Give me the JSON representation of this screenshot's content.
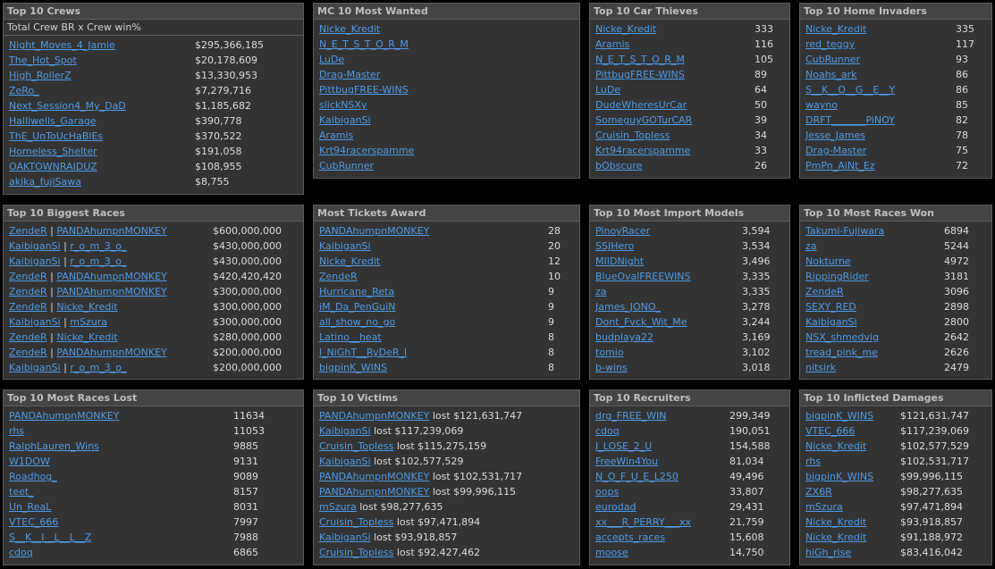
{
  "crews": {
    "title": "Top 10 Crews",
    "subtitle": "Total Crew BR x Crew win%",
    "rows": [
      {
        "name": "Night_Moves_4_Jamie",
        "value": "$295,366,185"
      },
      {
        "name": "The_Hot_Spot",
        "value": "$20,178,609"
      },
      {
        "name": "High_RollerZ",
        "value": "$13,330,953"
      },
      {
        "name": "ZeRo_",
        "value": "$7,279,716"
      },
      {
        "name": "Next_Session4_My_DaD",
        "value": "$1,185,682"
      },
      {
        "name": "Halliwells_Garage",
        "value": "$390,778"
      },
      {
        "name": "ThE_UnToUcHaBlEs",
        "value": "$370,522"
      },
      {
        "name": "Homeless_Shelter",
        "value": "$191,058"
      },
      {
        "name": "OAKTOWNRAIDUZ",
        "value": "$108,955"
      },
      {
        "name": "akika_fujiSawa",
        "value": "$8,755"
      }
    ]
  },
  "most_wanted": {
    "title": "MC 10 Most Wanted",
    "rows": [
      {
        "name": "Nicke_Kredit"
      },
      {
        "name": "N_E_T_S_T_O_R_M"
      },
      {
        "name": "LuDe"
      },
      {
        "name": "Drag-Master"
      },
      {
        "name": "PittbugFREE-WINS"
      },
      {
        "name": "slickNSXy"
      },
      {
        "name": "KaibiganSi"
      },
      {
        "name": "Aramis"
      },
      {
        "name": "Krt94racerspamme"
      },
      {
        "name": "CubRunner"
      }
    ]
  },
  "car_thieves": {
    "title": "Top 10 Car Thieves",
    "rows": [
      {
        "name": "Nicke_Kredit",
        "value": "333"
      },
      {
        "name": "Aramis",
        "value": "116"
      },
      {
        "name": "N_E_T_S_T_O_R_M",
        "value": "105"
      },
      {
        "name": "PittbugFREE-WINS",
        "value": "89"
      },
      {
        "name": "LuDe",
        "value": "64"
      },
      {
        "name": "DudeWheresUrCar",
        "value": "50"
      },
      {
        "name": "SomeguyGOTurCAR",
        "value": "39"
      },
      {
        "name": "Cruisin_Topless",
        "value": "34"
      },
      {
        "name": "Krt94racerspamme",
        "value": "33"
      },
      {
        "name": "bObscure",
        "value": "26"
      }
    ]
  },
  "home_invaders": {
    "title": "Top 10 Home Invaders",
    "rows": [
      {
        "name": "Nicke_Kredit",
        "value": "335"
      },
      {
        "name": "red_teggy",
        "value": "117"
      },
      {
        "name": "CubRunner",
        "value": "93"
      },
      {
        "name": "Noahs_ark",
        "value": "86"
      },
      {
        "name": "S__K__O__G__E__Y",
        "value": "86"
      },
      {
        "name": "wayno",
        "value": "85"
      },
      {
        "name": "DRFT_______PiNOY",
        "value": "82"
      },
      {
        "name": "Jesse_James",
        "value": "78"
      },
      {
        "name": "Drag-Master",
        "value": "75"
      },
      {
        "name": "PmPn_AiNt_Ez",
        "value": "72"
      }
    ]
  },
  "biggest_races": {
    "title": "Top 10 Biggest Races",
    "rows": [
      {
        "a": "ZendeR",
        "sep": " | ",
        "b": "PANDAhumpnMONKEY",
        "value": "$600,000,000"
      },
      {
        "a": "KaibiganSi",
        "sep": " | ",
        "b": "r_o_m_3_o_",
        "value": "$430,000,000"
      },
      {
        "a": "KaibiganSi",
        "sep": " | ",
        "b": "r_o_m_3_o_",
        "value": "$430,000,000"
      },
      {
        "a": "ZendeR",
        "sep": " | ",
        "b": "PANDAhumpnMONKEY",
        "value": "$420,420,420"
      },
      {
        "a": "ZendeR",
        "sep": " | ",
        "b": "PANDAhumpnMONKEY",
        "value": "$300,000,000"
      },
      {
        "a": "ZendeR",
        "sep": " | ",
        "b": "Nicke_Kredit",
        "value": "$300,000,000"
      },
      {
        "a": "KaibiganSi",
        "sep": " | ",
        "b": "mSzura",
        "value": "$300,000,000"
      },
      {
        "a": "ZendeR",
        "sep": " | ",
        "b": "Nicke_Kredit",
        "value": "$280,000,000"
      },
      {
        "a": "ZendeR",
        "sep": " | ",
        "b": "PANDAhumpnMONKEY",
        "value": "$200,000,000"
      },
      {
        "a": "KaibiganSi",
        "sep": " | ",
        "b": "r_o_m_3_o_",
        "value": "$200,000,000"
      }
    ]
  },
  "tickets": {
    "title": "Most Tickets Award",
    "rows": [
      {
        "name": "PANDAhumpnMONKEY",
        "value": "28"
      },
      {
        "name": "KaibiganSi",
        "value": "20"
      },
      {
        "name": "Nicke_Kredit",
        "value": "12"
      },
      {
        "name": "ZendeR",
        "value": "10"
      },
      {
        "name": "Hurricane_Reta",
        "value": "9"
      },
      {
        "name": "iM_Da_PenGuiN",
        "value": "9"
      },
      {
        "name": "all_show_no_go",
        "value": "9"
      },
      {
        "name": "Latino__heat",
        "value": "8"
      },
      {
        "name": "l_NiGhT__RyDeR_l",
        "value": "8"
      },
      {
        "name": "bigpinK_WINS",
        "value": "8"
      }
    ]
  },
  "import_models": {
    "title": "Top 10 Most Import Models",
    "rows": [
      {
        "name": "PinoyRacer",
        "value": "3,594"
      },
      {
        "name": "SSJHero",
        "value": "3,534"
      },
      {
        "name": "MIIDNight",
        "value": "3,496"
      },
      {
        "name": "BlueOvalFREEWINS",
        "value": "3,335"
      },
      {
        "name": "za",
        "value": "3,335"
      },
      {
        "name": "James_JONO_",
        "value": "3,278"
      },
      {
        "name": "Dont_Fvck_Wit_Me",
        "value": "3,244"
      },
      {
        "name": "budplaya22",
        "value": "3,169"
      },
      {
        "name": "tomio",
        "value": "3,102"
      },
      {
        "name": "b-wins",
        "value": "3,018"
      }
    ]
  },
  "races_won": {
    "title": "Top 10 Most Races Won",
    "rows": [
      {
        "name": "Takumi-Fujiwara",
        "value": "6894"
      },
      {
        "name": "za",
        "value": "5244"
      },
      {
        "name": "Nokturne",
        "value": "4972"
      },
      {
        "name": "RippingRider",
        "value": "3181"
      },
      {
        "name": "ZendeR",
        "value": "3096"
      },
      {
        "name": "SEXY_RED",
        "value": "2898"
      },
      {
        "name": "KaibiganSi",
        "value": "2800"
      },
      {
        "name": "NSX_shmedvig",
        "value": "2642"
      },
      {
        "name": "tread_pink_me",
        "value": "2626"
      },
      {
        "name": "nitsirk",
        "value": "2479"
      }
    ]
  },
  "races_lost": {
    "title": "Top 10 Most Races Lost",
    "rows": [
      {
        "name": "PANDAhumpnMONKEY",
        "value": "11634"
      },
      {
        "name": "rhs",
        "value": "11053"
      },
      {
        "name": "RalphLauren_Wins",
        "value": "9885"
      },
      {
        "name": "W1DOW",
        "value": "9131"
      },
      {
        "name": "Roadhog_",
        "value": "9089"
      },
      {
        "name": "teet_",
        "value": "8157"
      },
      {
        "name": "Un_ReaL",
        "value": "8031"
      },
      {
        "name": "VTEC_666",
        "value": "7997"
      },
      {
        "name": "S__K__I__L__L__Z",
        "value": "7988"
      },
      {
        "name": "cdoq",
        "value": "6865"
      }
    ]
  },
  "victims": {
    "title": "Top 10 Victims",
    "rows": [
      {
        "name": "PANDAhumpnMONKEY",
        "value": " lost $121,631,747"
      },
      {
        "name": "KaibiganSi",
        "value": " lost $117,239,069"
      },
      {
        "name": "Cruisin_Topless",
        "value": " lost $115,275,159"
      },
      {
        "name": "KaibiganSi",
        "value": " lost $102,577,529"
      },
      {
        "name": "PANDAhumpnMONKEY",
        "value": " lost $102,531,717"
      },
      {
        "name": "PANDAhumpnMONKEY",
        "value": " lost $99,996,115"
      },
      {
        "name": "mSzura",
        "value": " lost $98,277,635"
      },
      {
        "name": "Cruisin_Topless",
        "value": " lost $97,471,894"
      },
      {
        "name": "KaibiganSi",
        "value": " lost $93,918,857"
      },
      {
        "name": "Cruisin_Topless",
        "value": " lost $92,427,462"
      }
    ]
  },
  "recruiters": {
    "title": "Top 10 Recruiters",
    "rows": [
      {
        "name": "drg_FREE_WIN",
        "value": "299,349"
      },
      {
        "name": "cdoq",
        "value": "190,051"
      },
      {
        "name": "I_LOSE_2_U",
        "value": "154,588"
      },
      {
        "name": "FreeWin4You",
        "value": "81,034"
      },
      {
        "name": "N_O_F_U_E_L250",
        "value": "49,496"
      },
      {
        "name": "oops",
        "value": "33,807"
      },
      {
        "name": "eurodad",
        "value": "29,431"
      },
      {
        "name": "xx___R_PERRY___xx",
        "value": "21,759"
      },
      {
        "name": "accepts_races",
        "value": "15,608"
      },
      {
        "name": "moose",
        "value": "14,750"
      }
    ]
  },
  "inflicted": {
    "title": "Top 10 Inflicted Damages",
    "rows": [
      {
        "name": "bigpinK_WINS",
        "value": "$121,631,747"
      },
      {
        "name": "VTEC_666",
        "value": "$117,239,069"
      },
      {
        "name": "Nicke_Kredit",
        "value": "$102,577,529"
      },
      {
        "name": "rhs",
        "value": "$102,531,717"
      },
      {
        "name": "bigpinK_WINS",
        "value": "$99,996,115"
      },
      {
        "name": "ZX6R",
        "value": "$98,277,635"
      },
      {
        "name": "mSzura",
        "value": "$97,471,894"
      },
      {
        "name": "Nicke_Kredit",
        "value": "$93,918,857"
      },
      {
        "name": "Nicke_Kredit",
        "value": "$91,188,972"
      },
      {
        "name": "hiGh_rise",
        "value": "$83,416,042"
      }
    ]
  },
  "colors": {
    "background": "#000000",
    "panel": "#333333",
    "title_bar": "#444444",
    "link": "#4f9be6",
    "text": "#dddddd"
  }
}
